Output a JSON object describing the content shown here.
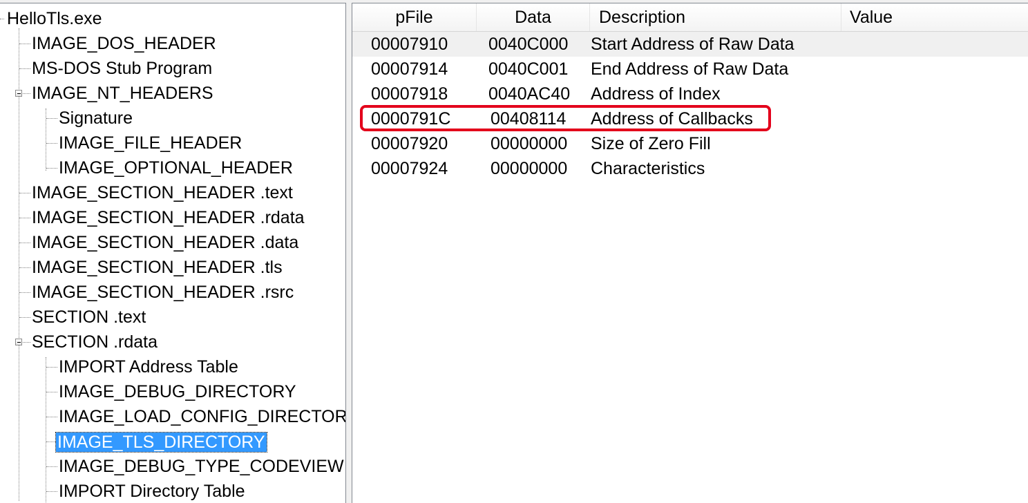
{
  "tree": {
    "items": [
      {
        "label": "HelloTls.exe"
      },
      {
        "label": "IMAGE_DOS_HEADER"
      },
      {
        "label": "MS-DOS Stub Program"
      },
      {
        "label": "IMAGE_NT_HEADERS"
      },
      {
        "label": "Signature"
      },
      {
        "label": "IMAGE_FILE_HEADER"
      },
      {
        "label": "IMAGE_OPTIONAL_HEADER"
      },
      {
        "label": "IMAGE_SECTION_HEADER .text"
      },
      {
        "label": "IMAGE_SECTION_HEADER .rdata"
      },
      {
        "label": "IMAGE_SECTION_HEADER .data"
      },
      {
        "label": "IMAGE_SECTION_HEADER .tls"
      },
      {
        "label": "IMAGE_SECTION_HEADER .rsrc"
      },
      {
        "label": "SECTION .text"
      },
      {
        "label": "SECTION .rdata"
      },
      {
        "label": "IMPORT Address Table"
      },
      {
        "label": "IMAGE_DEBUG_DIRECTORY"
      },
      {
        "label": "IMAGE_LOAD_CONFIG_DIRECTORY"
      },
      {
        "label": "IMAGE_TLS_DIRECTORY"
      },
      {
        "label": "IMAGE_DEBUG_TYPE_CODEVIEW"
      },
      {
        "label": "IMPORT Directory Table"
      }
    ],
    "selected": "IMAGE_TLS_DIRECTORY"
  },
  "list": {
    "columns": [
      "pFile",
      "Data",
      "Description",
      "Value"
    ],
    "rows": [
      {
        "pfile": "00007910",
        "data": "0040C000",
        "description": "Start Address of Raw Data",
        "value": ""
      },
      {
        "pfile": "00007914",
        "data": "0040C001",
        "description": "End Address of Raw Data",
        "value": ""
      },
      {
        "pfile": "00007918",
        "data": "0040AC40",
        "description": "Address of Index",
        "value": ""
      },
      {
        "pfile": "0000791C",
        "data": "00408114",
        "description": "Address of Callbacks",
        "value": ""
      },
      {
        "pfile": "00007920",
        "data": "00000000",
        "description": "Size of Zero Fill",
        "value": ""
      },
      {
        "pfile": "00007924",
        "data": "00000000",
        "description": "Characteristics",
        "value": ""
      }
    ],
    "hovered_row": 0,
    "highlighted_row": 3
  },
  "colors": {
    "selection": "#3399ff",
    "annotation": "#e3001b"
  }
}
